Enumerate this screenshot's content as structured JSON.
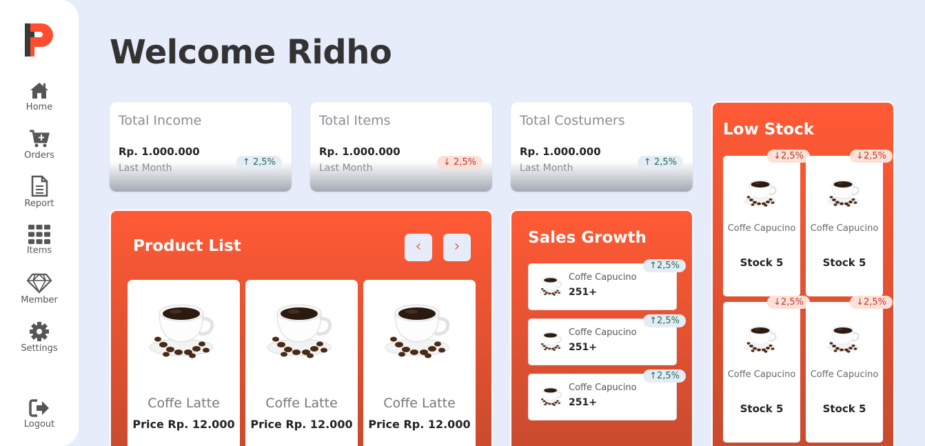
{
  "sidebar": {
    "logo": "P",
    "items": [
      {
        "label": "Home",
        "icon": "home-icon"
      },
      {
        "label": "Orders",
        "icon": "cart-icon"
      },
      {
        "label": "Report",
        "icon": "document-icon"
      },
      {
        "label": "Items",
        "icon": "grid-icon"
      },
      {
        "label": "Member",
        "icon": "diamond-icon"
      },
      {
        "label": "Settings",
        "icon": "gear-icon"
      },
      {
        "label": "Logout",
        "icon": "logout-icon"
      }
    ]
  },
  "header": {
    "greeting": "Welcome",
    "name": "Ridho"
  },
  "stats": [
    {
      "title": "Total Income",
      "value": "Rp. 1.000.000",
      "period": "Last Month",
      "change": "2,5%",
      "direction": "up"
    },
    {
      "title": "Total Items",
      "value": "Rp. 1.000.000",
      "period": "Last Month",
      "change": "2,5%",
      "direction": "down"
    },
    {
      "title": "Total Costumers",
      "value": "Rp. 1.000.000",
      "period": "Last Month",
      "change": "2,5%",
      "direction": "up"
    }
  ],
  "arrows": {
    "up": "↑",
    "down": "↓",
    "prev": "‹",
    "next": "›"
  },
  "product_list": {
    "title": "Product List",
    "products": [
      {
        "name": "Coffe Latte",
        "price": "Price Rp. 12.000"
      },
      {
        "name": "Coffe Latte",
        "price": "Price Rp. 12.000"
      },
      {
        "name": "Coffe Latte",
        "price": "Price Rp. 12.000"
      }
    ]
  },
  "sales_growth": {
    "title": "Sales Growth",
    "items": [
      {
        "name": "Coffe Capucino",
        "value": "251+",
        "change": "2,5%"
      },
      {
        "name": "Coffe Capucino",
        "value": "251+",
        "change": "2,5%"
      },
      {
        "name": "Coffe Capucino",
        "value": "251+",
        "change": "2,5%"
      }
    ]
  },
  "low_stock": {
    "title": "Low Stock",
    "items": [
      {
        "name": "Coffe Capucino",
        "stock": "Stock 5",
        "change": "2,5%"
      },
      {
        "name": "Coffe Capucino",
        "stock": "Stock 5",
        "change": "2,5%"
      },
      {
        "name": "Coffe Capucino",
        "stock": "Stock 5",
        "change": "2,5%"
      },
      {
        "name": "Coffe Capucino",
        "stock": "Stock 5",
        "change": "2,5%"
      }
    ]
  },
  "colors": {
    "accent": "#ff5a35",
    "background": "#e6ecfa",
    "up": "#1f6b4e",
    "down": "#c0382a"
  }
}
